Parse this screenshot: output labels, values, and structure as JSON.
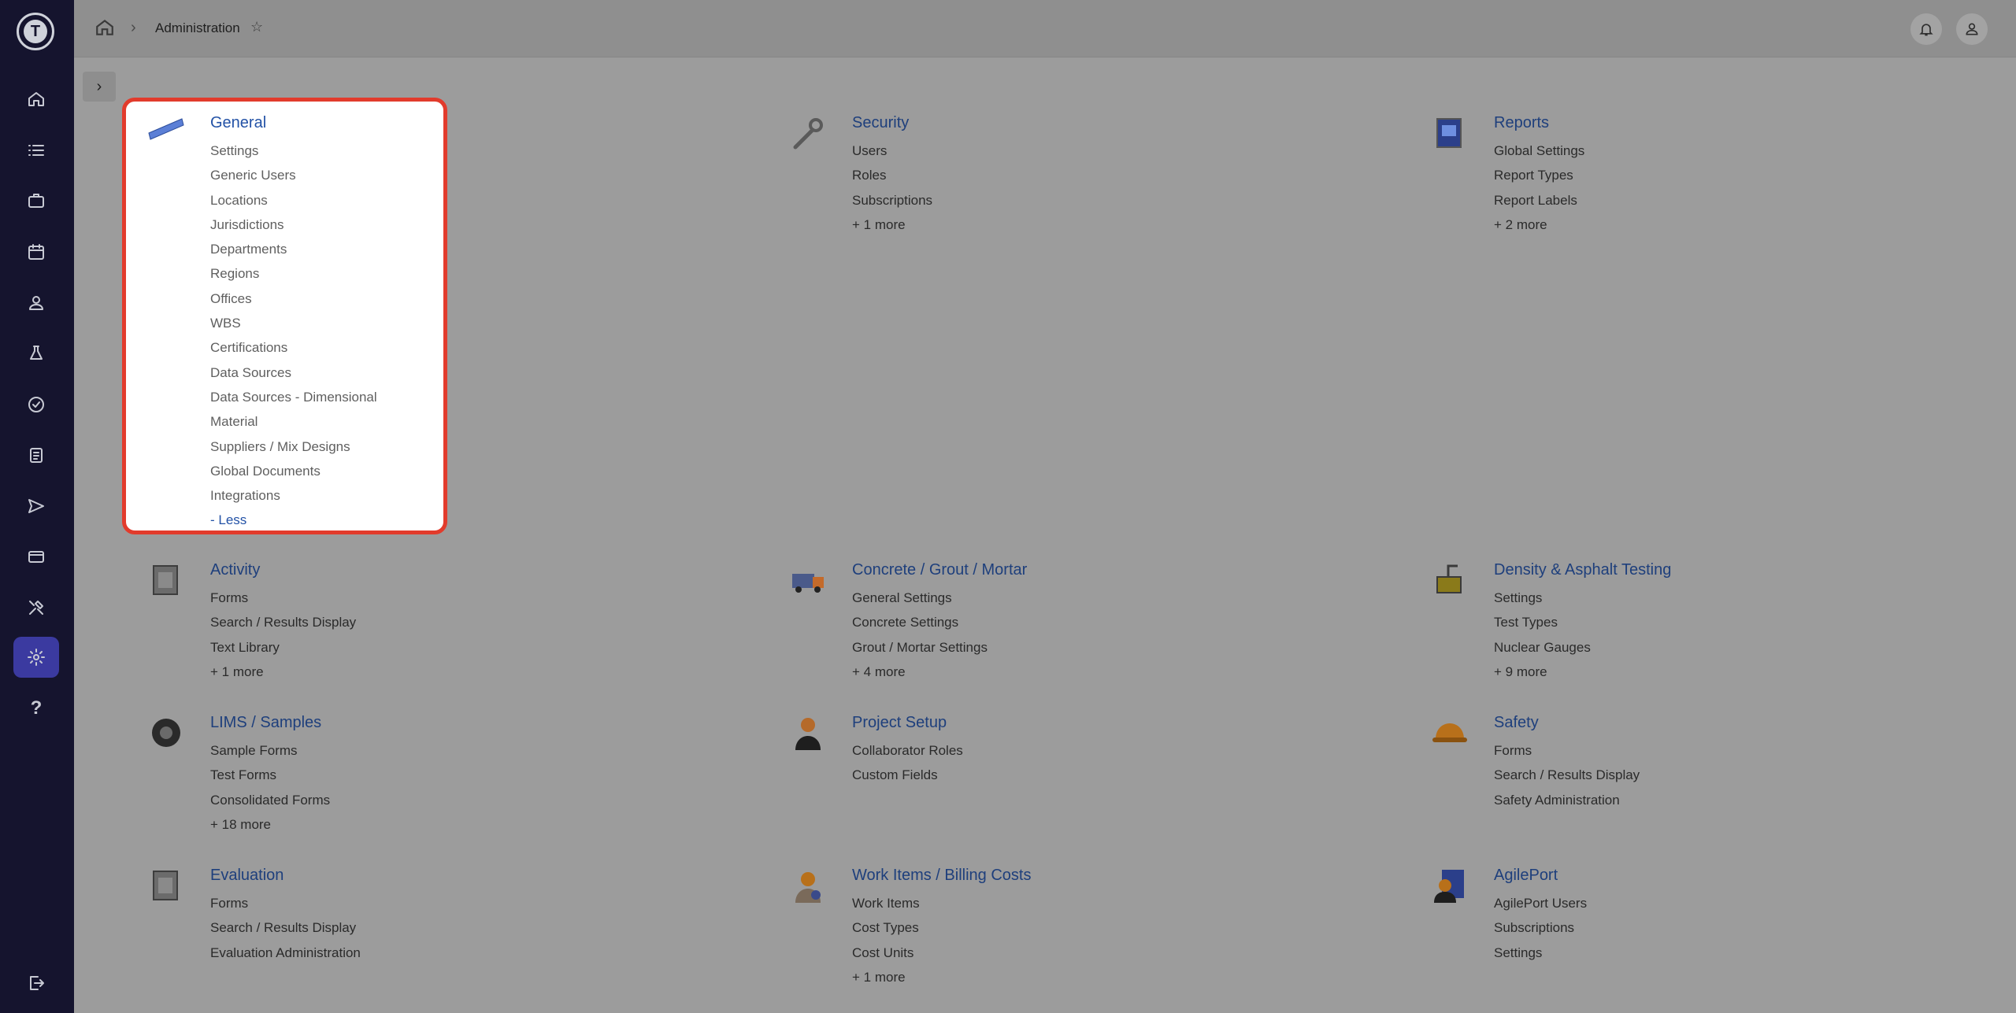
{
  "breadcrumb": {
    "current": "Administration"
  },
  "nav": {
    "logo_label": "T",
    "items": [
      {
        "icon": "home-icon"
      },
      {
        "icon": "list-icon"
      },
      {
        "icon": "briefcase-icon"
      },
      {
        "icon": "calendar-icon"
      },
      {
        "icon": "user-icon"
      },
      {
        "icon": "flask-icon"
      },
      {
        "icon": "badge-check-icon"
      },
      {
        "icon": "clipboard-icon"
      },
      {
        "icon": "send-icon"
      },
      {
        "icon": "credit-card-icon"
      },
      {
        "icon": "tools-icon"
      },
      {
        "icon": "gear-icon",
        "active": true
      },
      {
        "icon": "help-icon",
        "label": "?"
      },
      {
        "icon": "logout-icon"
      }
    ]
  },
  "sections": {
    "general": {
      "title": "General",
      "items": [
        "Settings",
        "Generic Users",
        "Locations",
        "Jurisdictions",
        "Departments",
        "Regions",
        "Offices",
        "WBS",
        "Certifications",
        "Data Sources",
        "Data Sources - Dimensional",
        "Material",
        "Suppliers / Mix Designs",
        "Global Documents",
        "Integrations"
      ],
      "less": "- Less"
    },
    "security": {
      "title": "Security",
      "items": [
        "Users",
        "Roles",
        "Subscriptions"
      ],
      "more": "+ 1 more"
    },
    "reports": {
      "title": "Reports",
      "items": [
        "Global Settings",
        "Report Types",
        "Report Labels"
      ],
      "more": "+ 2 more"
    },
    "activity": {
      "title": "Activity",
      "items": [
        "Forms",
        "Search / Results Display",
        "Text Library"
      ],
      "more": "+ 1 more"
    },
    "concrete": {
      "title": "Concrete / Grout / Mortar",
      "items": [
        "General Settings",
        "Concrete Settings",
        "Grout / Mortar Settings"
      ],
      "more": "+ 4 more"
    },
    "density": {
      "title": "Density & Asphalt Testing",
      "items": [
        "Settings",
        "Test Types",
        "Nuclear Gauges"
      ],
      "more": "+ 9 more"
    },
    "lims": {
      "title": "LIMS / Samples",
      "items": [
        "Sample Forms",
        "Test Forms",
        "Consolidated Forms"
      ],
      "more": "+ 18 more"
    },
    "project": {
      "title": "Project Setup",
      "items": [
        "Collaborator Roles",
        "Custom Fields"
      ]
    },
    "safety": {
      "title": "Safety",
      "items": [
        "Forms",
        "Search / Results Display",
        "Safety Administration"
      ]
    },
    "evaluation": {
      "title": "Evaluation",
      "items": [
        "Forms",
        "Search / Results Display",
        "Evaluation Administration"
      ]
    },
    "workitems": {
      "title": "Work Items / Billing Costs",
      "items": [
        "Work Items",
        "Cost Types",
        "Cost Units"
      ],
      "more": "+ 1 more"
    },
    "agileport": {
      "title": "AgilePort",
      "items": [
        "AgilePort Users",
        "Subscriptions",
        "Settings"
      ]
    }
  }
}
